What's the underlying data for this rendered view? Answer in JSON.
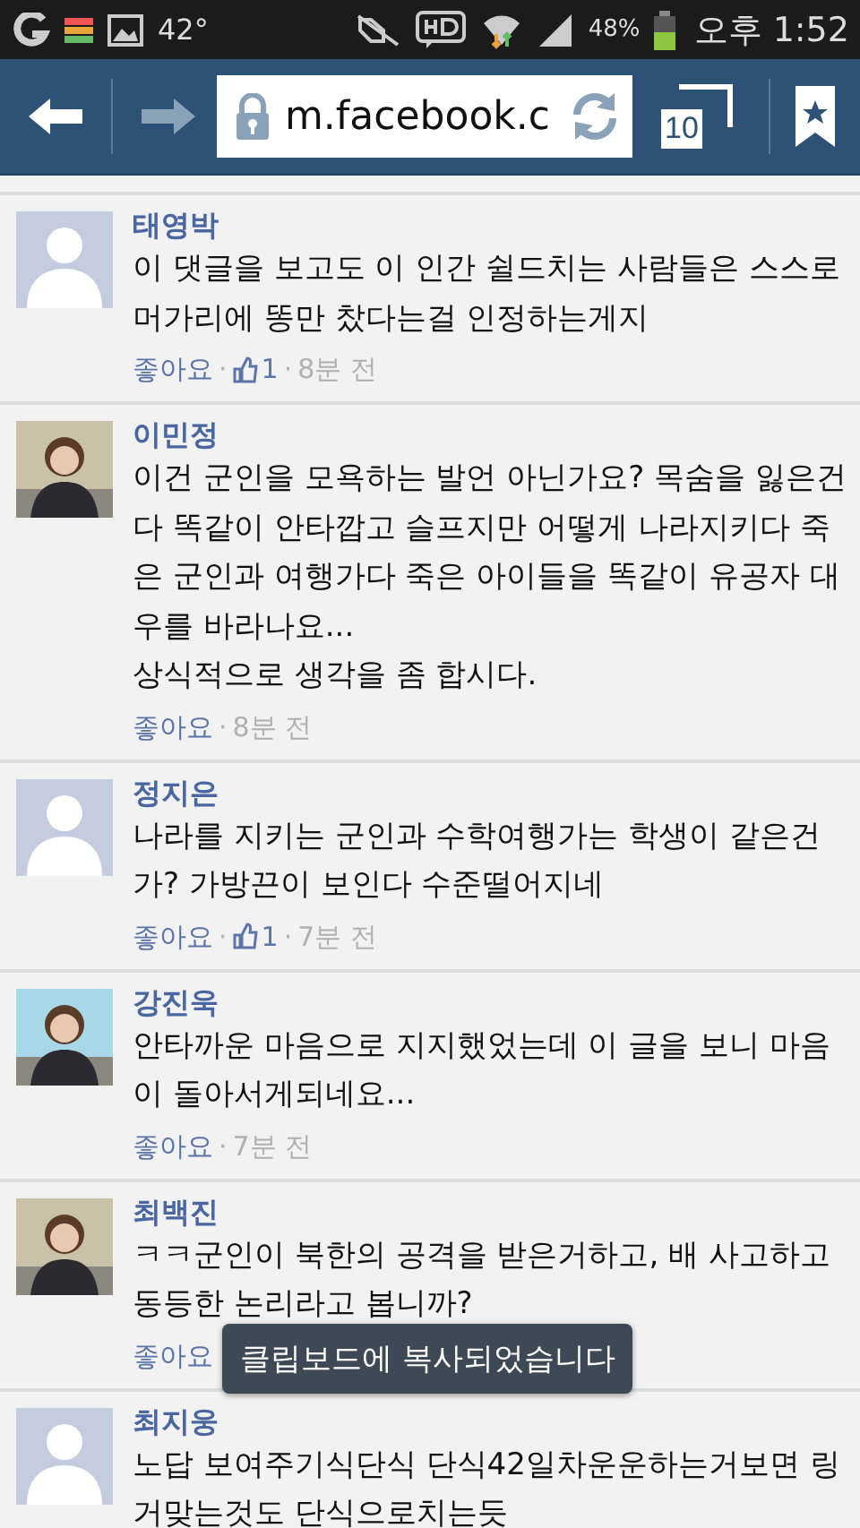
{
  "status_bar": {
    "temperature": "42°",
    "battery": "48%",
    "time": "오후 1:52"
  },
  "browser": {
    "url": "m.facebook.c",
    "tab_count": "10"
  },
  "comments": [
    {
      "name": "태영박",
      "avatar_photo": false,
      "text": "이 댓글을 보고도 이 인간 쉴드치는 사람들은 스스로 머가리에 똥만 찼다는걸 인정하는게지",
      "meta": [
        {
          "kind": "like",
          "text": "좋아요"
        },
        {
          "kind": "dot",
          "text": "·"
        },
        {
          "kind": "count",
          "text": "1"
        },
        {
          "kind": "dot",
          "text": "·"
        },
        {
          "kind": "time",
          "text": "8분 전"
        }
      ]
    },
    {
      "name": "이민정",
      "avatar_photo": true,
      "text": "이건 군인을 모욕하는 발언 아닌가요? 목숨을 잃은건 다 똑같이 안타깝고 슬프지만 어떻게 나라지키다 죽은 군인과 여행가다 죽은 아이들을 똑같이 유공자 대우를 바라나요...\n상식적으로 생각을 좀 합시다.",
      "meta": [
        {
          "kind": "like",
          "text": "좋아요"
        },
        {
          "kind": "dot",
          "text": "·"
        },
        {
          "kind": "time",
          "text": "8분 전"
        }
      ]
    },
    {
      "name": "정지은",
      "avatar_photo": false,
      "text": "나라를 지키는 군인과 수학여행가는 학생이 같은건가? 가방끈이 보인다 수준떨어지네",
      "meta": [
        {
          "kind": "like",
          "text": "좋아요"
        },
        {
          "kind": "dot",
          "text": "·"
        },
        {
          "kind": "count",
          "text": "1"
        },
        {
          "kind": "dot",
          "text": "·"
        },
        {
          "kind": "time",
          "text": "7분 전"
        }
      ]
    },
    {
      "name": "강진욱",
      "avatar_photo": true,
      "text": "안타까운 마음으로 지지했었는데 이 글을 보니 마음이 돌아서게되네요...",
      "meta": [
        {
          "kind": "like",
          "text": "좋아요"
        },
        {
          "kind": "dot",
          "text": "·"
        },
        {
          "kind": "time",
          "text": "7분 전"
        }
      ]
    },
    {
      "name": "최백진",
      "avatar_photo": true,
      "text": "ㅋㅋ군인이 북한의 공격을 받은거하고, 배 사고하고 동등한 논리라고 봅니까?",
      "meta": [
        {
          "kind": "like",
          "text": "좋아요"
        }
      ]
    },
    {
      "name": "최지웅",
      "avatar_photo": false,
      "text": "노답 보여주기식단식 단식42일차운운하는거보면 링거맞는것도 단식으로치는듯"
    }
  ],
  "toast": "클립보드에 복사되었습니다"
}
